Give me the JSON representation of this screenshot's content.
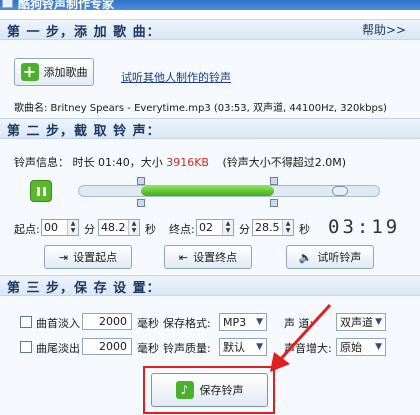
{
  "window": {
    "title": "酷狗铃声制作专家"
  },
  "step1": {
    "title": "第 一 步，添 加 歌 曲：",
    "help": "帮助>>",
    "add_button": "添加歌曲",
    "try_link": "试听其他人制作的铃声",
    "song_info": "歌曲名: Britney Spears - Everytime.mp3  (03:53, 双声道, 44100Hz,  320kbps)"
  },
  "step2": {
    "title": "第 二 步，截 取 铃 声：",
    "info_prefix": "铃声信息：  时长 01:40，大小",
    "size": "3916KB",
    "size_note": "(铃声大小不得超过2.0M)",
    "selection": {
      "start_fraction": 0.21,
      "end_fraction": 0.65
    },
    "start_label": "起点:",
    "start_min": "00",
    "min_unit": "分",
    "start_sec": "48.2",
    "sec_unit": "秒",
    "end_label": "终点:",
    "end_min": "02",
    "end_sec": "28.5",
    "time_display": "03:19",
    "set_start": "设置起点",
    "set_end": "设置终点",
    "preview": "试听铃声"
  },
  "step3": {
    "title": "第 三 步，保 存 设 置：",
    "fade_in_label": "曲首淡入",
    "fade_in_value": "2000",
    "fade_out_label": "曲尾淡出",
    "fade_out_value": "2000",
    "ms_unit": "毫秒",
    "format_label": "保存格式:",
    "format_value": "MP3",
    "quality_label": "铃声质量:",
    "quality_value": "默认",
    "channel_label": "声    道:",
    "channel_value": "双声道",
    "gain_label": "声音增大:",
    "gain_value": "原始",
    "save_button": "保存铃声"
  },
  "colors": {
    "accent": "#4caf2e",
    "size_text": "#d0281d",
    "highlight": "#e02020"
  }
}
